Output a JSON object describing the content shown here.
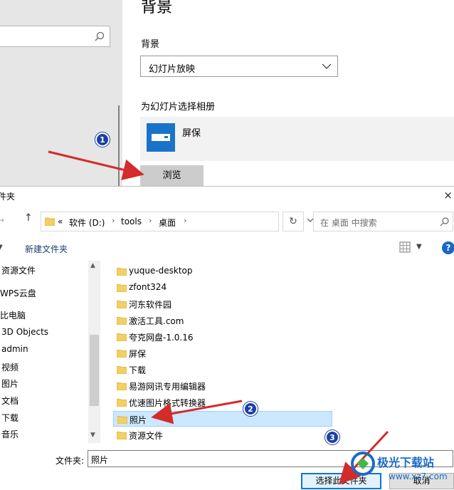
{
  "settings": {
    "title": "背景",
    "bg_label": "背景",
    "bg_select": "幻灯片放映",
    "album_label": "为幻灯片选择相册",
    "album_name": "屏保",
    "browse": "浏览"
  },
  "dialog": {
    "title": "件夹",
    "close": "×",
    "address": {
      "prefix": "«",
      "crumbs": [
        "软件 (D:)",
        "tools",
        "桌面"
      ]
    },
    "search_placeholder": "在 桌面 中搜索",
    "new_folder": "新建文件夹",
    "help": "?",
    "nav_items": [
      "资源文件",
      "WPS云盘",
      "比电脑",
      "3D Objects",
      "admin",
      "视频",
      "图片",
      "文档",
      "下载",
      "音乐"
    ],
    "files": [
      "yuque-desktop",
      "zfont324",
      "河东软件园",
      "激活工具.com",
      "夸克网盘-1.0.16",
      "屏保",
      "下载",
      "易游网讯专用编辑器",
      "优速图片格式转换器",
      "照片",
      "资源文件"
    ],
    "selected_file": "照片",
    "folder_label": "文件夹:",
    "folder_value": "照片",
    "select_button": "选择此文件夹",
    "cancel_button": "取消"
  },
  "annotations": {
    "badge1": "1",
    "badge2": "2",
    "badge3": "3"
  },
  "watermark": {
    "text": "极光下载站",
    "url": "www.xz7.com"
  },
  "colors": {
    "accent": "#0078d7",
    "selection": "#cce8ff",
    "badge": "#1c3fa8",
    "arrow": "#d42b2b",
    "tile": "#1a73c8"
  }
}
